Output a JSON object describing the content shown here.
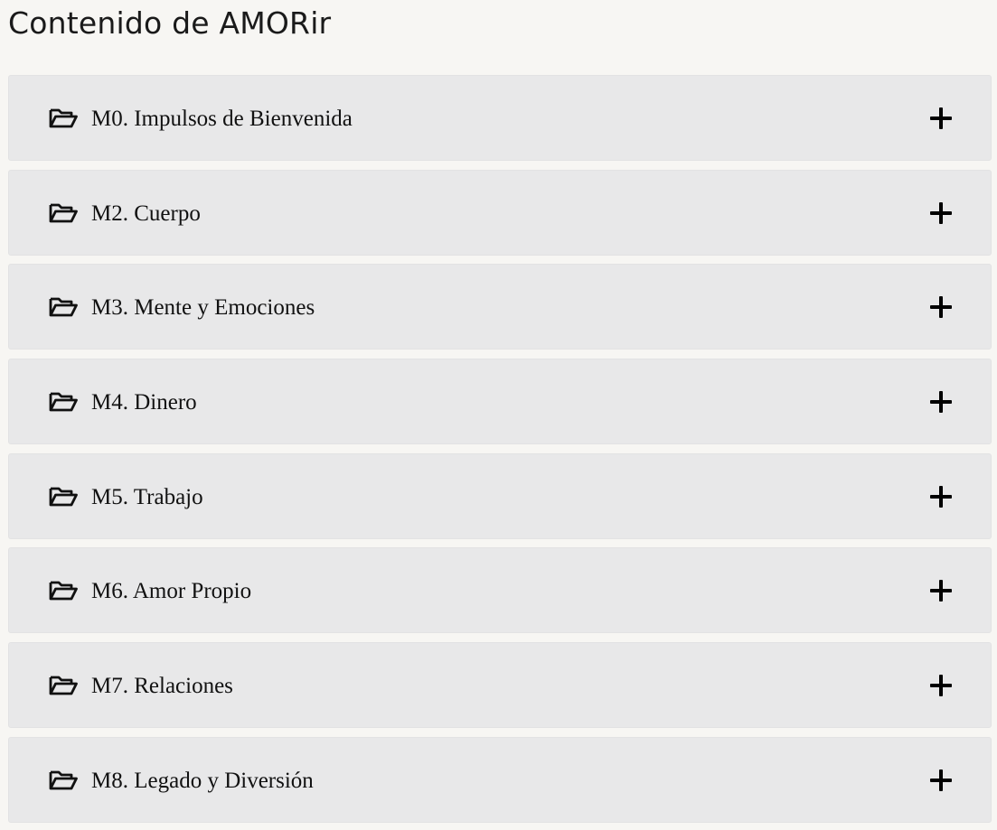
{
  "page": {
    "title": "Contenido de AMORir"
  },
  "accordion": {
    "items": [
      {
        "label": "M0. Impulsos de Bienvenida",
        "folder_icon": "folder-open-icon",
        "toggle_icon": "plus-icon",
        "expanded": false
      },
      {
        "label": "M2. Cuerpo",
        "folder_icon": "folder-open-icon",
        "toggle_icon": "plus-icon",
        "expanded": false
      },
      {
        "label": "M3. Mente y Emociones",
        "folder_icon": "folder-open-icon",
        "toggle_icon": "plus-icon",
        "expanded": false
      },
      {
        "label": "M4. Dinero",
        "folder_icon": "folder-open-icon",
        "toggle_icon": "plus-icon",
        "expanded": false
      },
      {
        "label": "M5. Trabajo",
        "folder_icon": "folder-open-icon",
        "toggle_icon": "plus-icon",
        "expanded": false
      },
      {
        "label": "M6. Amor Propio",
        "folder_icon": "folder-open-icon",
        "toggle_icon": "plus-icon",
        "expanded": false
      },
      {
        "label": "M7. Relaciones",
        "folder_icon": "folder-open-icon",
        "toggle_icon": "plus-icon",
        "expanded": false
      },
      {
        "label": "M8. Legado y Diversión",
        "folder_icon": "folder-open-icon",
        "toggle_icon": "plus-icon",
        "expanded": false
      }
    ]
  },
  "colors": {
    "background": "#f7f6f3",
    "item_background": "#e8e8e9",
    "text": "#111111"
  }
}
